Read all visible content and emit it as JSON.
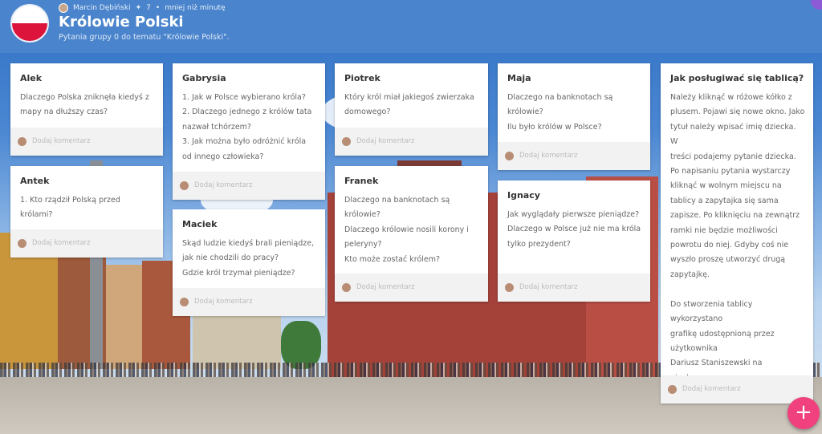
{
  "header": {
    "author": "Marcin Dębiński",
    "likes": "7",
    "time": "mniej niż minutę",
    "title": "Królowie Polski",
    "subtitle": "Pytania grupy 0 do tematu \"Królowie Polski\"."
  },
  "comment_label": "Dodaj komentarz",
  "cards": {
    "alek": {
      "name": "Alek",
      "text": "Dlaczego Polska zniknęła kiedyś z\nmapy na dłuższy czas?"
    },
    "antek": {
      "name": "Antek",
      "text": "1. Kto rządził Polską przed\nkrólami?"
    },
    "gabrysia": {
      "name": "Gabrysia",
      "text": "1. Jak w Polsce wybierano króla?\n2. Dlaczego jednego z królów tata\nnazwał tchórzem?\n3. Jak można było odróżnić króla\nod innego człowieka?"
    },
    "maciek": {
      "name": "Maciek",
      "text": "Skąd ludzie kiedyś brali pieniądze,\njak nie chodzili do pracy?\nGdzie król trzymał pieniądze?"
    },
    "piotrek": {
      "name": "Piotrek",
      "text": "Który król miał jakiegoś zwierzaka\ndomowego?"
    },
    "franek": {
      "name": "Franek",
      "text": "Dlaczego na banknotach są\nkrólowie?\nDlaczego królowie nosili korony i\npeleryny?\nKto może zostać królem?"
    },
    "maja": {
      "name": "Maja",
      "text": "Dlaczego na banknotach są\nkrólowie?\nIlu było królów w Polsce?"
    },
    "ignacy": {
      "name": "Ignacy",
      "text": "Jak wyglądały pierwsze pieniądze?\nDlaczego w Polsce już nie ma króla\ntylko prezydent?"
    },
    "help": {
      "name": "Jak posługiwać się tablicą?",
      "text": "Należy kliknąć w różowe kółko z\nplusem. Pojawi się nowe okno. Jako\ntytuł należy wpisać imię dziecka. W\ntreści podajemy pytanie dziecka.\nPo napisaniu pytania wystarczy\nkliknąć w wolnym miejscu na\ntablicy a zapytajka się sama\nzapisze. Po kliknięciu na zewnątrz\nramki nie będzie możliwości\npowrotu do niej. Gdyby coś nie\nwyszło proszę utworzyć drugą\nzapytajkę.\n\nDo stworzenia tablicy wykorzystano\ngrafikę udostępnioną przez\nużytkownika\nDariusz Staniszewski  na\npixabay.com"
    }
  },
  "fab_symbol": "+",
  "colors": {
    "header": "#4a84cc",
    "fab": "#f0407d"
  }
}
